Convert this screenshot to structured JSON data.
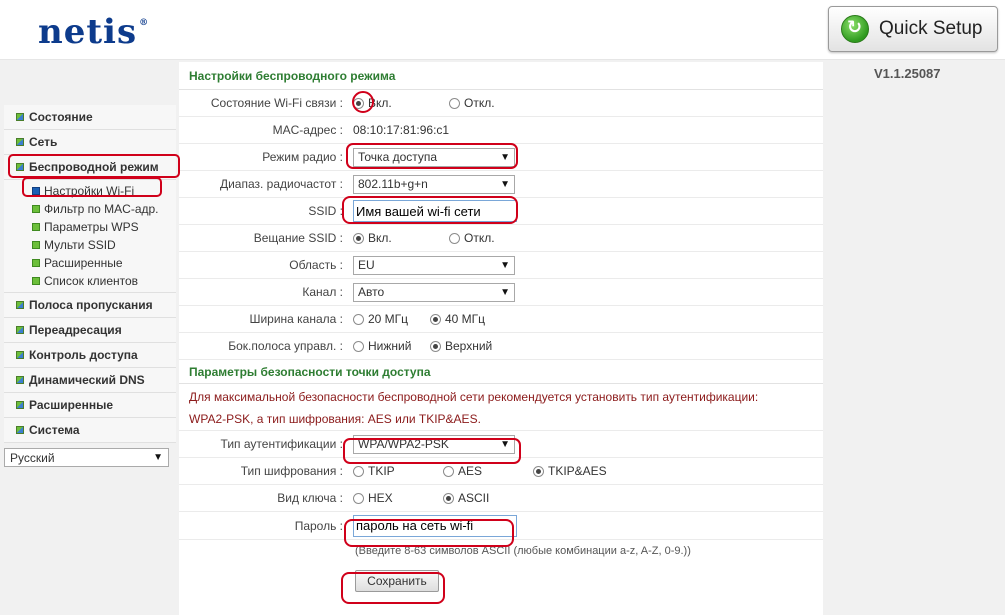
{
  "header": {
    "logo": "netis",
    "logo_mark": "®",
    "quick_setup": "Quick Setup",
    "version": "V1.1.25087"
  },
  "sidebar": {
    "items": [
      {
        "label": "Состояние"
      },
      {
        "label": "Сеть"
      },
      {
        "label": "Беспроводной режим"
      },
      {
        "label": "Полоса пропускания"
      },
      {
        "label": "Переадресация"
      },
      {
        "label": "Контроль доступа"
      },
      {
        "label": "Динамический DNS"
      },
      {
        "label": "Расширенные"
      },
      {
        "label": "Система"
      }
    ],
    "subitems": [
      {
        "label": "Настройки Wi-Fi"
      },
      {
        "label": "Фильтр по MAC-адр."
      },
      {
        "label": "Параметры WPS"
      },
      {
        "label": "Мульти SSID"
      },
      {
        "label": "Расширенные"
      },
      {
        "label": "Список клиентов"
      }
    ],
    "language": "Русский"
  },
  "wireless": {
    "title": "Настройки беспроводного режима",
    "wifi_state": {
      "label": "Состояние Wi-Fi связи :",
      "on": "Вкл.",
      "off": "Откл."
    },
    "mac": {
      "label": "MAC-адрес :",
      "value": "08:10:17:81:96:c1"
    },
    "radio_mode": {
      "label": "Режим радио :",
      "value": "Точка доступа"
    },
    "band": {
      "label": "Диапаз. радиочастот :",
      "value": "802.11b+g+n"
    },
    "ssid": {
      "label": "SSID :",
      "value": "Имя вашей wi-fi сети"
    },
    "broadcast": {
      "label": "Вещание SSID :",
      "on": "Вкл.",
      "off": "Откл."
    },
    "region": {
      "label": "Область :",
      "value": "EU"
    },
    "channel": {
      "label": "Канал :",
      "value": "Авто"
    },
    "bandwidth": {
      "label": "Ширина канала :",
      "opt1": "20 МГц",
      "opt2": "40 МГц"
    },
    "sideband": {
      "label": "Бок.полоса управл. :",
      "opt1": "Нижний",
      "opt2": "Верхний"
    }
  },
  "security": {
    "title": "Параметры безопасности точки доступа",
    "note1": "Для максимальной безопасности беспроводной сети рекомендуется установить тип аутентификации:",
    "note2": "WPA2-PSK, а тип шифрования: AES или TKIP&AES.",
    "auth": {
      "label": "Тип аутентификации :",
      "value": "WPA/WPA2-PSK"
    },
    "cipher": {
      "label": "Тип шифрования :",
      "opt1": "TKIP",
      "opt2": "AES",
      "opt3": "TKIP&AES"
    },
    "key_type": {
      "label": "Вид ключа :",
      "opt1": "HEX",
      "opt2": "ASCII"
    },
    "password": {
      "label": "Пароль :",
      "value": "пароль на сеть wi-fi"
    },
    "hint": "(Введите 8-63 символов ASCII (любые комбинации a-z, A-Z, 0-9.))",
    "save": "Сохранить"
  },
  "colors": {
    "annotation": "#d0001a",
    "section_title": "#2e7d32",
    "logo": "#0d3b8c"
  }
}
